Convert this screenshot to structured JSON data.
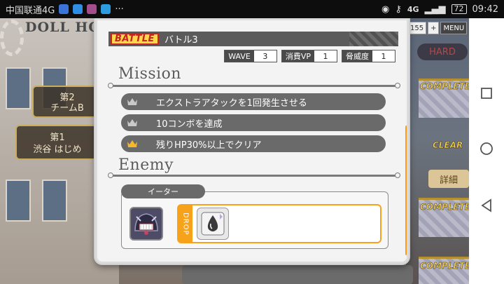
{
  "statusbar": {
    "carrier": "中国联通4G",
    "more": "···",
    "network": "4G",
    "battery": "72",
    "time": "09:42"
  },
  "background": {
    "building_sign": "DOLL HO",
    "card_mid_line1": "第2",
    "card_mid_line2": "チームB",
    "card_low_line1": "第1",
    "card_low_line2": "渋谷 はじめ",
    "top_counter": "155",
    "top_plus": "+",
    "menu": "MENU",
    "hard": "HARD",
    "complete": "COMPLETE",
    "clear": "CLEAR",
    "detail": "詳細"
  },
  "modal": {
    "battle_badge": "BATTLE",
    "title": "バトル3",
    "stats": [
      {
        "label": "WAVE",
        "value": "3"
      },
      {
        "label": "消費VP",
        "value": "1"
      },
      {
        "label": "脅威度",
        "value": "1"
      }
    ],
    "mission_heading": "Mission",
    "missions": [
      {
        "text": "エクストラアタックを1回発生させる",
        "achieved": false
      },
      {
        "text": "10コンボを達成",
        "achieved": false
      },
      {
        "text": "残りHP30%以上でクリア",
        "achieved": true
      }
    ],
    "enemy_heading": "Enemy",
    "enemy": {
      "name": "イーター",
      "drop_label": "DROP"
    }
  },
  "colors": {
    "crown_inactive": "#c9c9c9",
    "crown_active": "#f5b829",
    "accent_orange": "#f7a21b",
    "battle_yellow": "#ffd84a",
    "battle_red": "#c4261d"
  },
  "icons": {
    "crown": "crown-icon",
    "enemy": "eater-monster-icon",
    "drop_item": "droplet-item-icon",
    "nav_back": "back-triangle-icon",
    "nav_home": "home-circle-icon",
    "nav_recent": "recent-square-icon"
  }
}
